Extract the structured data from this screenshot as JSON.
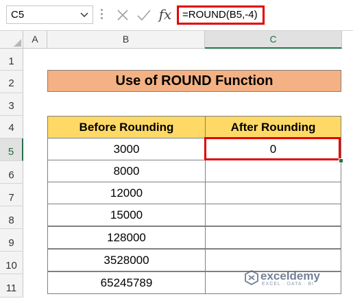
{
  "formula_bar": {
    "name_box": "C5",
    "formula": "=ROUND(B5,-4)",
    "fx_label": "fx"
  },
  "columns": [
    "A",
    "B",
    "C"
  ],
  "rows": [
    "1",
    "2",
    "3",
    "4",
    "5",
    "6",
    "7",
    "8",
    "9",
    "10",
    "11"
  ],
  "sheet": {
    "title": "Use of ROUND Function",
    "headers": [
      "Before Rounding",
      "After Rounding"
    ],
    "before_values": [
      "3000",
      "8000",
      "12000",
      "15000",
      "128000",
      "3528000",
      "65245789"
    ],
    "after_values": [
      "0",
      "",
      "",
      "",
      "",
      "",
      ""
    ]
  },
  "watermark": {
    "name": "exceldemy",
    "tagline": "EXCEL · DATA · BI"
  },
  "colors": {
    "title_fill": "#f4b183",
    "header_fill": "#ffd966",
    "highlight_border": "#e00000",
    "excel_green": "#217346"
  }
}
